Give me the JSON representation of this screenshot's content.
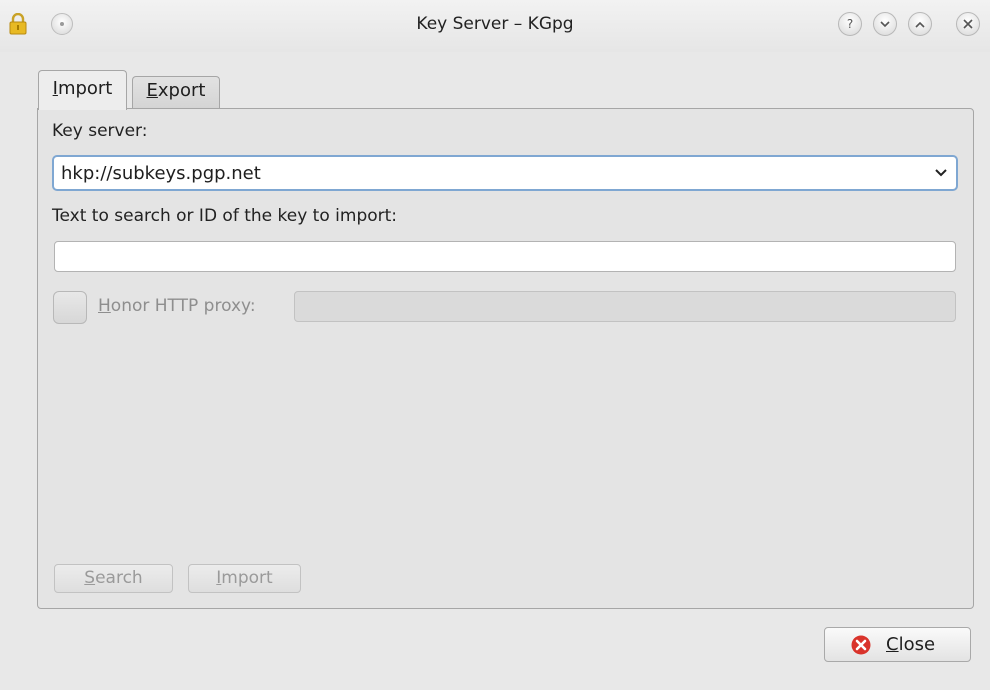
{
  "window": {
    "title": "Key Server – KGpg"
  },
  "tabs": [
    {
      "label_mnemonic": "I",
      "label_rest": "mport"
    },
    {
      "label_mnemonic": "E",
      "label_rest": "xport"
    }
  ],
  "import_tab": {
    "key_server_label": "Key server:",
    "key_server_value": "hkp://subkeys.pgp.net",
    "search_label": "Text to search or ID of the key to import:",
    "search_value": "",
    "honor_proxy_mnemonic": "H",
    "honor_proxy_rest": "onor HTTP proxy:",
    "proxy_value": "",
    "search_button_mnemonic": "S",
    "search_button_rest": "earch",
    "import_button_mnemonic": "I",
    "import_button_rest": "mport"
  },
  "footer": {
    "close_mnemonic": "C",
    "close_rest": "lose"
  },
  "colors": {
    "accent_border": "#7fa7d2",
    "close_icon": "#d9332b"
  }
}
